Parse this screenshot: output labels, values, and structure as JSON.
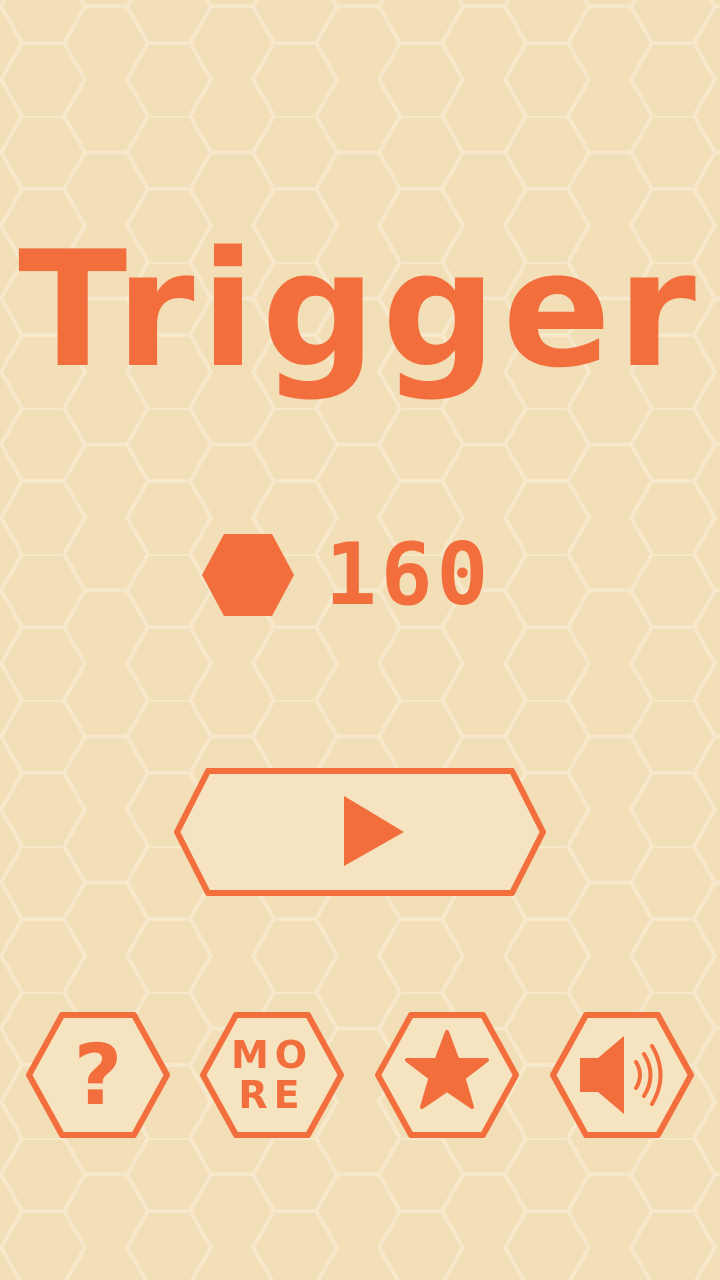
{
  "game": {
    "title": "Trigger",
    "score": "160",
    "score_icon": "hexagon-icon"
  },
  "buttons": {
    "play": {
      "icon": "play-icon"
    },
    "help": {
      "label": "?",
      "icon": "question-icon"
    },
    "more": {
      "line1": "MO",
      "line2": "RE",
      "icon": "more-text-icon"
    },
    "rate": {
      "icon": "star-icon"
    },
    "sound": {
      "icon": "speaker-icon"
    }
  },
  "colors": {
    "accent": "#f26f3d",
    "background": "#f2deb7",
    "button_fill": "#f6e3c0",
    "honeycomb_line": "#f7e8cb"
  }
}
